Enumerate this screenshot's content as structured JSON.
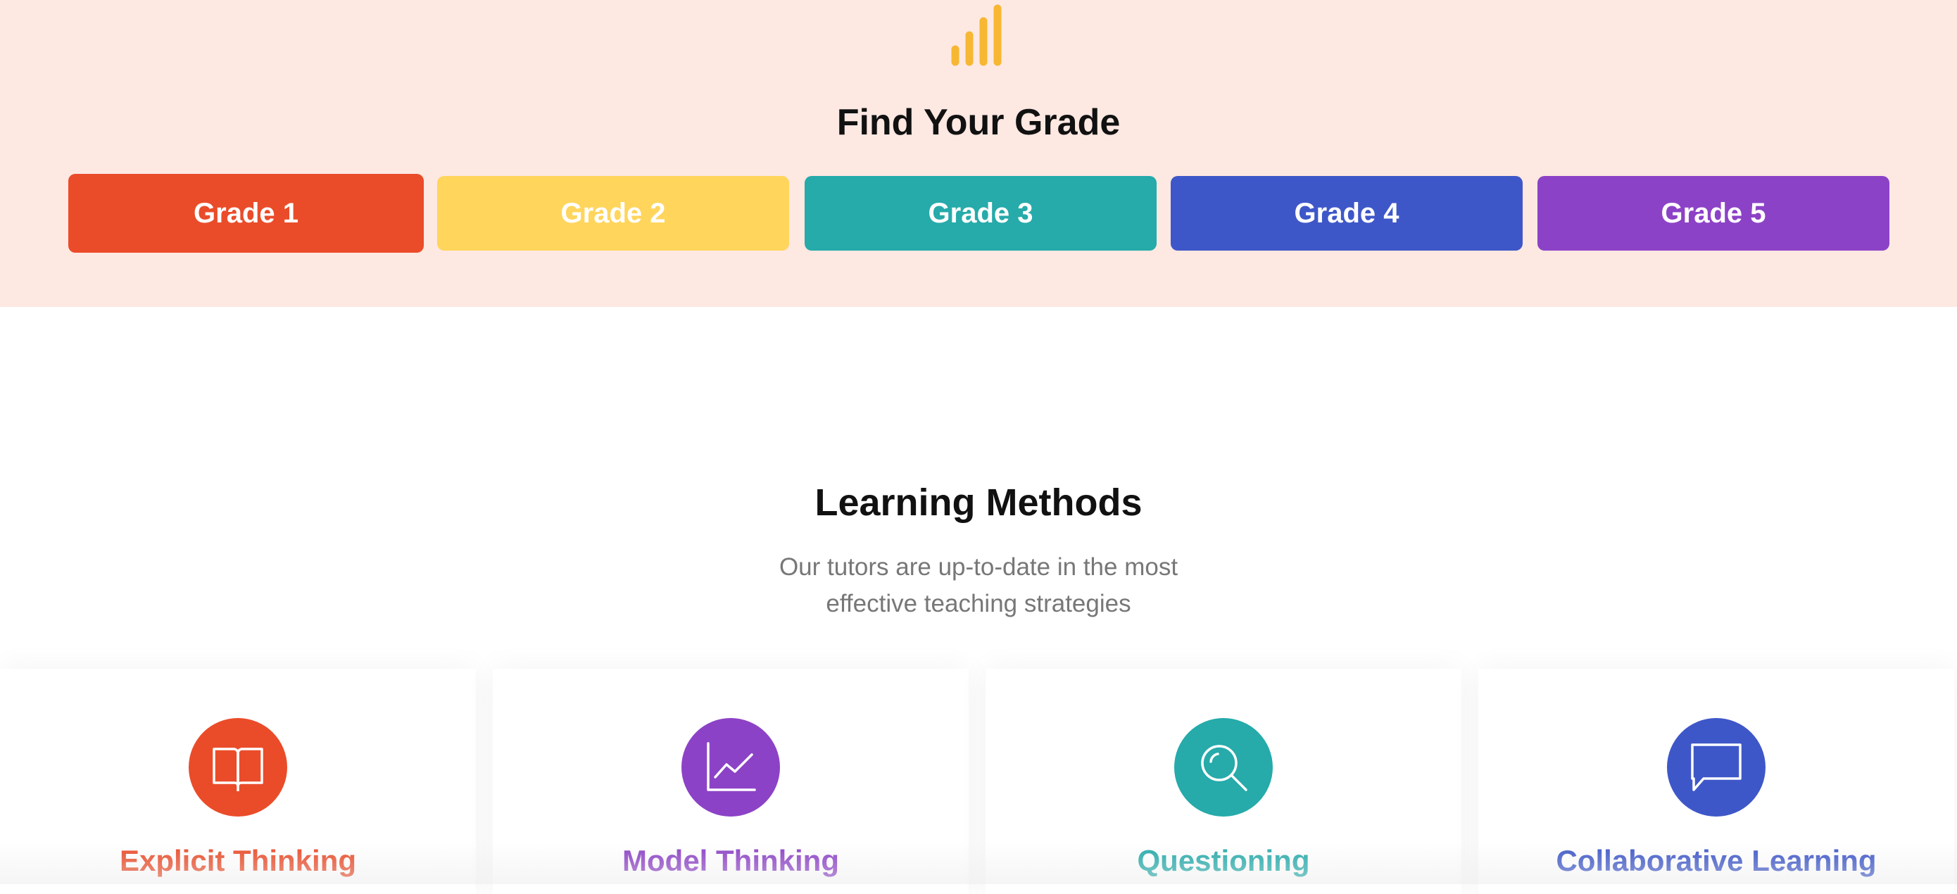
{
  "grade_section": {
    "title": "Find Your Grade",
    "icon": "signal-bars-icon",
    "buttons": [
      {
        "label": "Grade 1",
        "color": "#ea4c2a"
      },
      {
        "label": "Grade 2",
        "color": "#ffd55c"
      },
      {
        "label": "Grade 3",
        "color": "#26aaaa"
      },
      {
        "label": "Grade 4",
        "color": "#3e57c8"
      },
      {
        "label": "Grade 5",
        "color": "#8c42c6"
      }
    ]
  },
  "methods_section": {
    "title": "Learning Methods",
    "subtitle_line1": "Our tutors are up-to-date in the most",
    "subtitle_line2": "effective teaching strategies",
    "cards": [
      {
        "title": "Explicit Thinking",
        "icon": "open-book-icon",
        "color": "#ea4c2a"
      },
      {
        "title": "Model Thinking",
        "icon": "line-chart-icon",
        "color": "#8c42c6"
      },
      {
        "title": "Questioning",
        "icon": "magnifier-icon",
        "color": "#26aaaa"
      },
      {
        "title": "Collaborative Learning",
        "icon": "chat-bubble-icon",
        "color": "#3e57c8"
      }
    ]
  },
  "colors": {
    "section_bg": "#fde8e2",
    "icon_accent": "#f7b733"
  }
}
